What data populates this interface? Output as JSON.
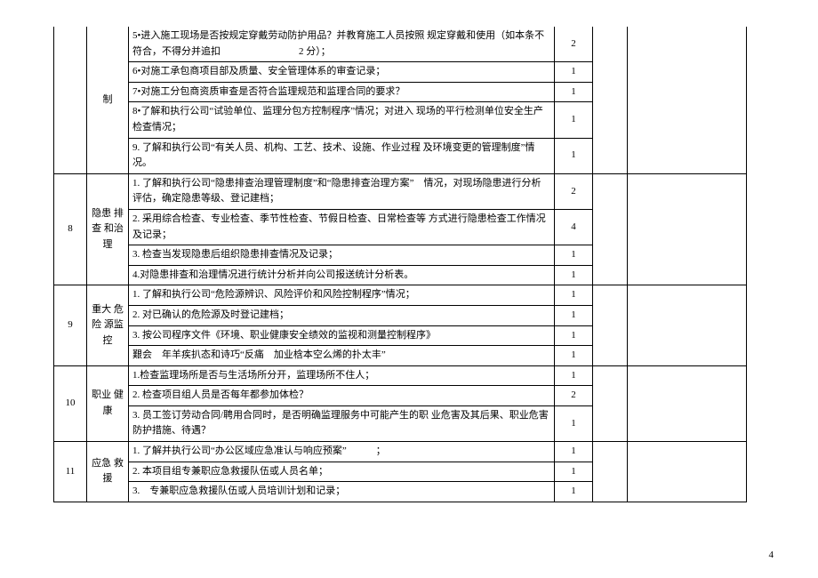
{
  "page_number": "4",
  "sections": [
    {
      "idx": "",
      "cat_top": "制",
      "items": [
        {
          "text": "5•进入施工现场是否按规定穿戴劳动防护用品？并教育施工人员按照 规定穿戴和使用（如本条不符合，不得分并追扣　　　　　　　　2 分）；",
          "score": "2"
        },
        {
          "text": "6•对施工承包商项目部及质量、安全管理体系的审查记录；",
          "score": "1"
        },
        {
          "text": "7•对施工分包商资质审查是否符合监理规范和监理合同的要求？",
          "score": "1"
        },
        {
          "text": "8•了解和执行公司“试验单位、监理分包方控制程序”情况；对进入 现场的平行检测单位安全生产检查情况；",
          "score": "1"
        },
        {
          "text": "9. 了解和执行公司“有关人员、机构、工艺、技术、设施、作业过程 及环境变更的管理制度”情况。",
          "score": "1"
        }
      ]
    },
    {
      "idx": "8",
      "cat": "隐患 排查 和治理",
      "items": [
        {
          "text": "1. 了解和执行公司“隐患排查治理管理制度”和“隐患排查治理方案”　情况，对现场隐患进行分析评估，确定隐患等级、登记建档；",
          "score": "2"
        },
        {
          "text": "2. 采用综合检查、专业检查、季节性检查、节假日检查、日常检查等 方式进行隐患检查工作情况及记录；",
          "score": "4"
        },
        {
          "text": "3. 检查当发现隐患后组织隐患排查情况及记录；",
          "score": "1"
        },
        {
          "text": "4.对隐患排查和治理情况进行统计分析并向公司报送统计分析表。",
          "score": "1"
        }
      ]
    },
    {
      "idx": "9",
      "cat": "重大 危险 源监控",
      "items": [
        {
          "text": "1. 了解和执行公司“危险源辨识、风险评价和风险控制程序”情况；",
          "score": "1"
        },
        {
          "text": "2. 对已确认的危险源及时登记建档；",
          "score": "1"
        },
        {
          "text": "3. 按公司程序文件《环境、职业健康安全绩效的监视和测量控制程序》",
          "score": "1"
        },
        {
          "text": "艱会　年羊疾扒态和诗巧“反痛　加业梒本空么烯的扑太丰”",
          "score": "1"
        }
      ]
    },
    {
      "idx": "10",
      "cat": "职业 健康",
      "items": [
        {
          "text": "1.检查监理场所是否与生活场所分开，监理场所不住人；",
          "score": "1"
        },
        {
          "text": "2. 检查项目组人员是否每年都参加体检？",
          "score": "2"
        },
        {
          "text": "3. 员工签订劳动合同/聘用合同时，是否明确监理服务中可能产生的职 业危害及其后果、职业危害防护措施、待遇？",
          "score": "1"
        }
      ]
    },
    {
      "idx": "11",
      "cat": "应急 救援",
      "items": [
        {
          "text": "1. 了解并执行公司“办公区域应急准认与响应预案”　　　；",
          "score": "1"
        },
        {
          "text": "2. 本项目组专兼职应急救援队伍或人员名单；",
          "score": "1"
        },
        {
          "text": "3.　专兼职应急救援队伍或人员培训计划和记录；",
          "score": "1"
        }
      ]
    }
  ]
}
